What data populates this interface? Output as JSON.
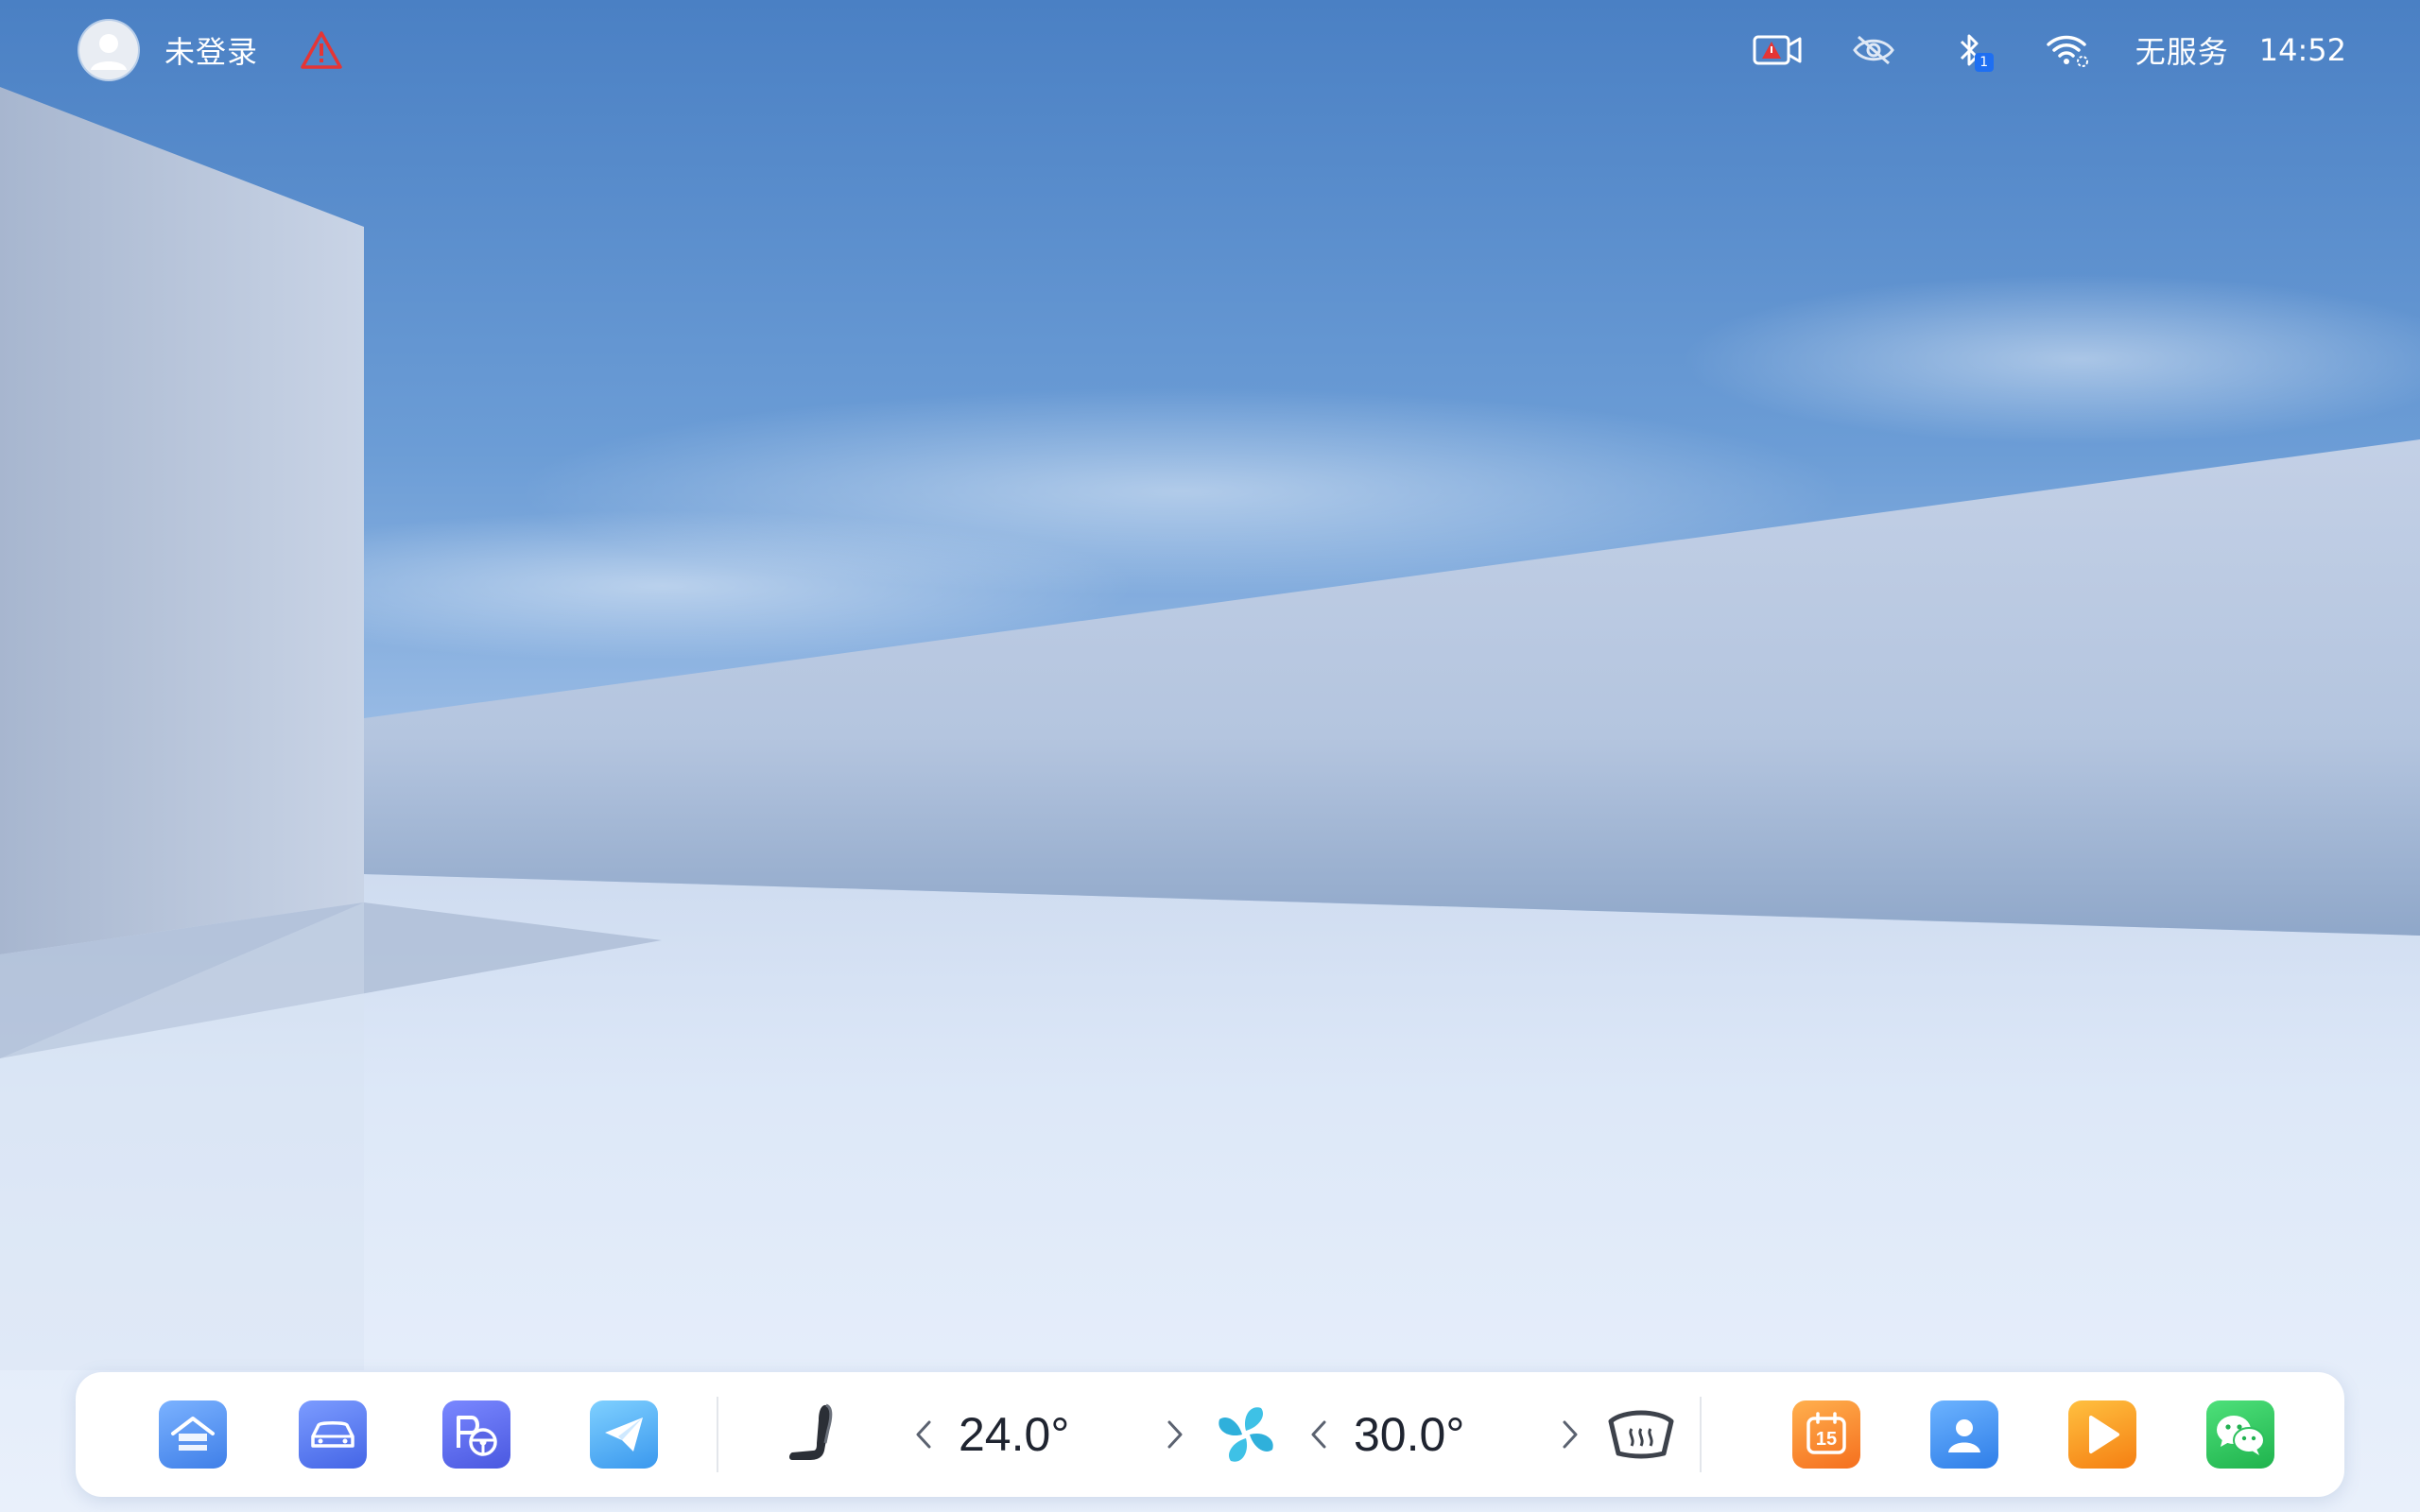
{
  "status_bar": {
    "user_label": "未登录",
    "network_status": "无服务",
    "time": "14:52",
    "bluetooth_badge": "1",
    "icons": [
      "avatar",
      "warning-triangle-icon",
      "camera-warning-icon",
      "eye-off-icon",
      "bluetooth-icon",
      "wifi-icon"
    ]
  },
  "dock": {
    "left_apps": [
      {
        "name": "home-app",
        "icon": "house-icon",
        "color": "#4d8ef0"
      },
      {
        "name": "car-app",
        "icon": "car-icon",
        "color": "#4f78ee"
      },
      {
        "name": "parking-app",
        "icon": "parking-steering-icon",
        "color": "#5567e8"
      },
      {
        "name": "navigation-app",
        "icon": "paper-plane-icon",
        "color": "#4aa6ee"
      }
    ],
    "climate": {
      "seat_icon": "seat-icon",
      "driver_temp": "24.0°",
      "fan_icon": "fan-icon",
      "passenger_temp": "30.0°",
      "defrost_icon": "rear-defrost-icon"
    },
    "right_apps": [
      {
        "name": "calendar-app",
        "icon": "calendar-icon",
        "label": "15",
        "color": "#f7882a"
      },
      {
        "name": "contacts-app",
        "icon": "person-icon",
        "color": "#3d8ef3"
      },
      {
        "name": "video-app",
        "icon": "play-icon",
        "color": "#f79421"
      },
      {
        "name": "wechat-app",
        "icon": "wechat-icon",
        "color": "#26c15a"
      }
    ]
  }
}
